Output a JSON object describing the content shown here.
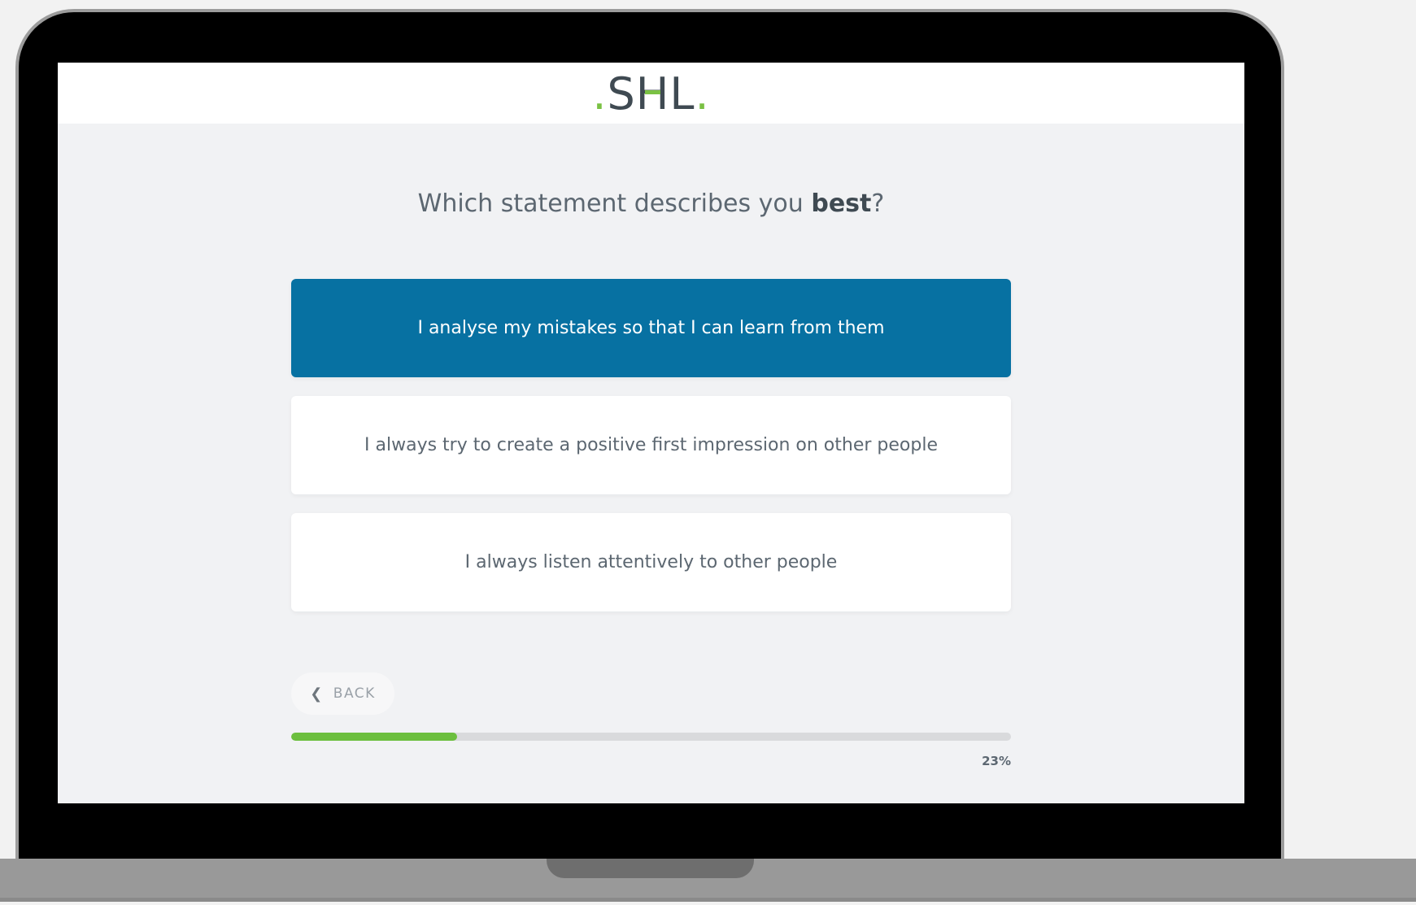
{
  "header": {
    "logo_dot_left": ".",
    "logo_text_s": "S",
    "logo_text_h": "H",
    "logo_text_l": "L",
    "logo_dot_right": "."
  },
  "question": {
    "prefix": "Which statement describes you ",
    "emphasis": "best",
    "suffix": "?"
  },
  "options": [
    {
      "label": "I analyse my mistakes so that I can learn from them",
      "selected": true
    },
    {
      "label": "I always try to create a positive first impression on other people",
      "selected": false
    },
    {
      "label": "I always listen attentively to other people",
      "selected": false
    }
  ],
  "navigation": {
    "back_label": "BACK",
    "back_icon": "chevron-left-icon"
  },
  "progress": {
    "percent": 23,
    "label": "23%"
  },
  "colors": {
    "selected_option": "#0771a2",
    "progress_fill": "#6cbf3e",
    "logo_accent": "#7ac143"
  }
}
